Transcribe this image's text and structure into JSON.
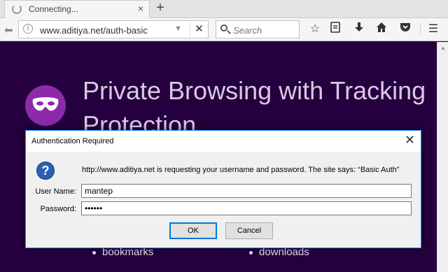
{
  "tab": {
    "title": "Connecting...",
    "close": "×"
  },
  "newtab": "+",
  "navbar": {
    "url": "www.aditiya.net/auth-basic",
    "search_placeholder": "Search",
    "info_glyph": "i",
    "dropdown_glyph": "▼",
    "stop_glyph": "✕"
  },
  "icons": {
    "back": "back-arrow-icon",
    "bookmark_star": "star-icon",
    "reading_list": "reading-list-icon",
    "downloads": "download-arrow-icon",
    "home": "home-icon",
    "pocket": "pocket-icon",
    "menu": "hamburger-menu-icon"
  },
  "page": {
    "heading": "Private Browsing with Tracking Protection",
    "links": [
      "bookmarks",
      "downloads"
    ],
    "accent_color": "#8d2aa8",
    "background_color": "#25003e"
  },
  "dialog": {
    "title": "Authentication Required",
    "close": "✕",
    "icon_glyph": "?",
    "message": "http://www.aditiya.net is requesting your username and password. The site says: “Basic Auth”",
    "username_label": "User Name:",
    "username_value": "mantep",
    "password_label": "Password:",
    "password_value": "••••••",
    "ok_label": "OK",
    "cancel_label": "Cancel"
  }
}
